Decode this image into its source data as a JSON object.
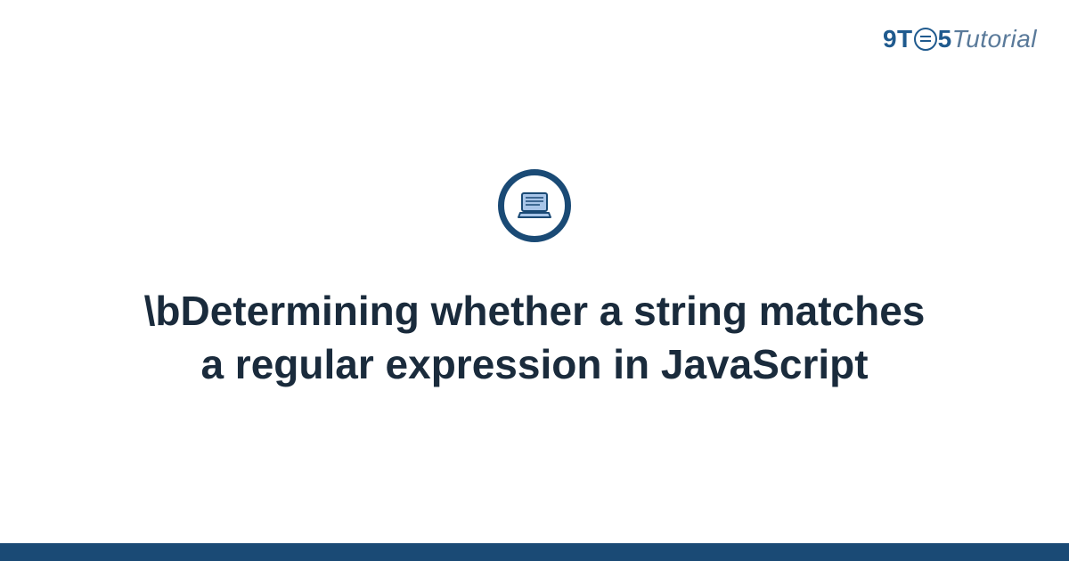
{
  "logo": {
    "nine": "9",
    "t": "T",
    "five": "5",
    "tutorial": "Tutorial"
  },
  "title": "\\bDetermining whether a string matches a regular expression in JavaScript",
  "colors": {
    "brand_primary": "#1a4a75",
    "brand_secondary": "#1f5a8e",
    "text": "#1a2b3c",
    "icon_fill": "#a8c5e8"
  }
}
